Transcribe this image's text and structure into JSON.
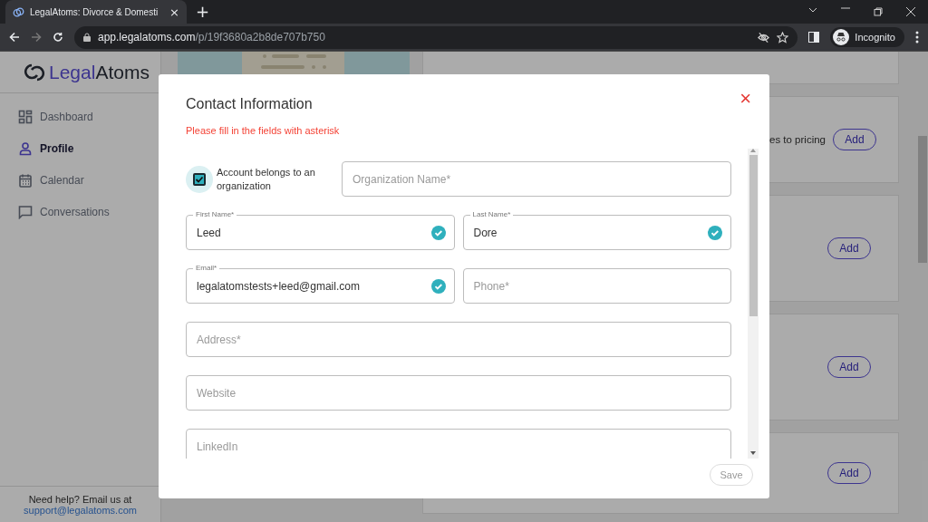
{
  "browser": {
    "tab": {
      "title": "LegalAtoms: Divorce & Domesti",
      "close": "×"
    },
    "new_tab": "+",
    "url_host": "app.legalatoms.com",
    "url_path": "/p/19f3680a2b8de707b750",
    "profile": "Incognito"
  },
  "sidebar": {
    "logo": "Legal**Atoms**",
    "items": [
      {
        "label": "Dashboard",
        "selected": false
      },
      {
        "label": "Profile",
        "selected": true
      },
      {
        "label": "Calendar",
        "selected": false
      },
      {
        "label": "Conversations",
        "selected": false
      }
    ],
    "help_text": "Need help? Email us at",
    "help_link": "support@legalatoms.com"
  },
  "cards": [
    {
      "text": "es to pricing",
      "button": "Add"
    },
    {
      "button": "Add"
    },
    {
      "button": "Add"
    },
    {
      "button": "Add"
    }
  ],
  "dialog": {
    "title": "Contact Information",
    "close": "×",
    "error": "Please fill in the fields with asterisk",
    "checkbox": {
      "label": "Account belongs to an organization",
      "checked": true
    },
    "field_rows": [
      {
        "fields": [
          {
            "placeholder": "Organization Name*",
            "valid": false
          }
        ]
      },
      {
        "fields": [
          {
            "label": "First Name*",
            "value": "Leed",
            "valid": true
          },
          {
            "label": "Last Name*",
            "value": "Dore",
            "valid": true
          }
        ]
      },
      {
        "fields": [
          {
            "label": "Email*",
            "value": "legalatomstests+leed@gmail.com",
            "valid": true
          },
          {
            "placeholder": "Phone*",
            "valid": false
          }
        ]
      },
      {
        "fields": [
          {
            "placeholder": "Address*",
            "valid": false
          }
        ]
      },
      {
        "fields": [
          {
            "placeholder": "Website",
            "valid": false
          }
        ]
      },
      {
        "fields": [
          {
            "placeholder": "LinkedIn",
            "valid": false
          }
        ]
      }
    ],
    "save": "Save"
  }
}
